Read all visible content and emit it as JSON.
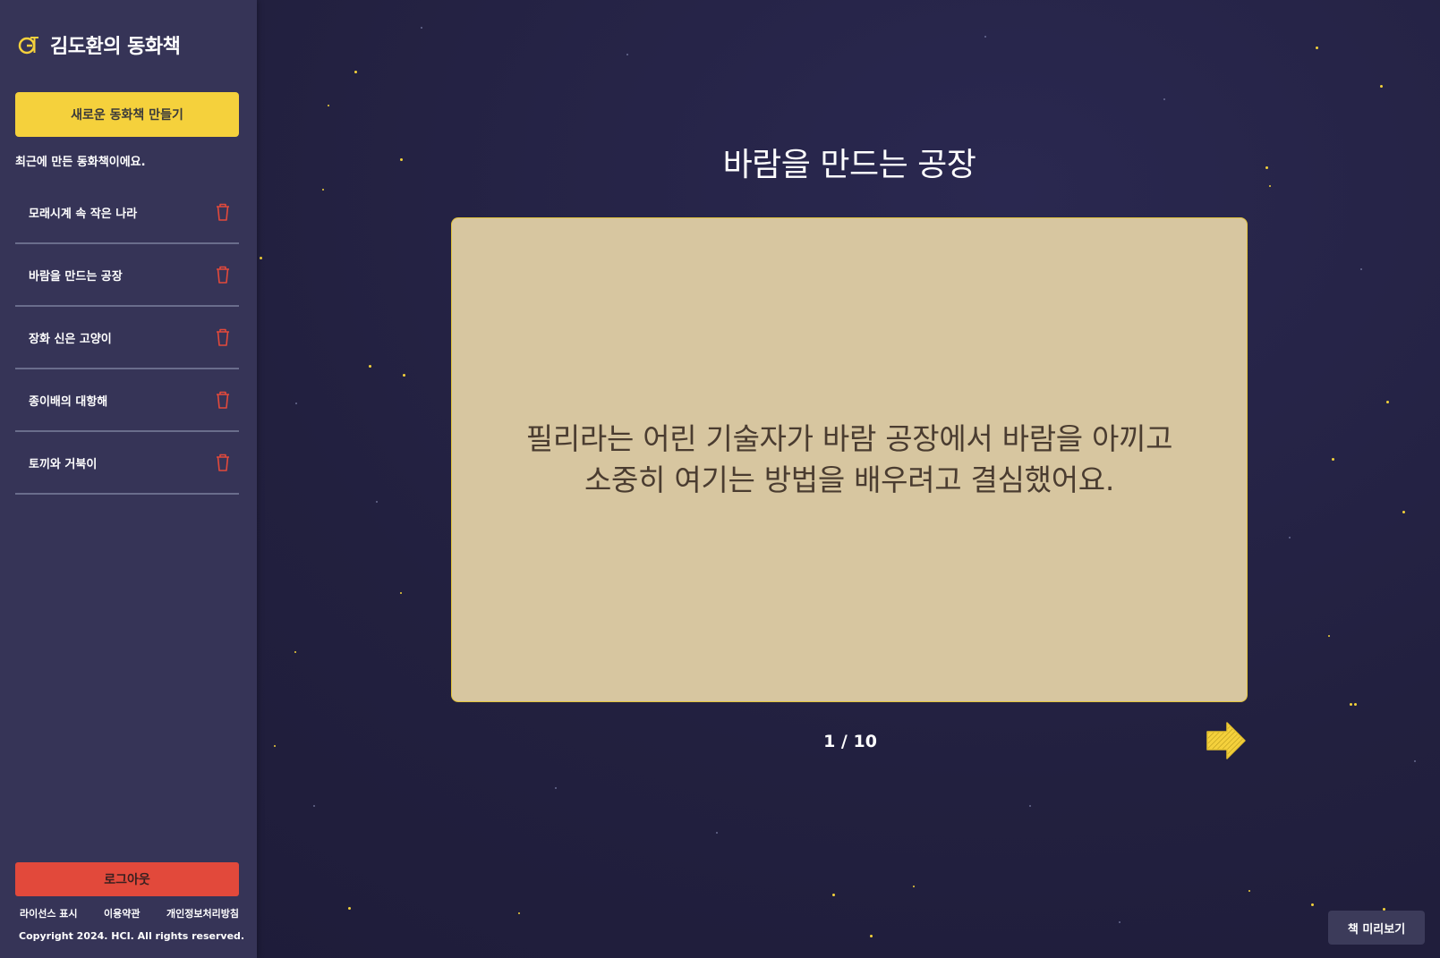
{
  "sidebar": {
    "brand": "김도환의 동화책",
    "new_book_button": "새로운 동화책 만들기",
    "recent_label": "최근에 만든 동화책이에요.",
    "books": [
      {
        "title": "모래시계 속 작은 나라"
      },
      {
        "title": "바람을 만드는 공장"
      },
      {
        "title": "장화 신은 고양이"
      },
      {
        "title": "종이배의 대항해"
      },
      {
        "title": "토끼와 거북이"
      }
    ],
    "logout_button": "로그아웃",
    "footer_links": [
      "라이선스 표시",
      "이용약관",
      "개인정보처리방침"
    ],
    "copyright": "Copyright 2024. HCI. All rights reserved."
  },
  "main": {
    "story_title": "바람을 만드는 공장",
    "page_text": "필리라는 어린 기술자가 바람 공장에서 바람을 아끼고 소중히 여기는 방법을 배우려고 결심했어요.",
    "page_indicator": "1 / 10",
    "preview_button": "책 미리보기"
  },
  "colors": {
    "background": "#22203f",
    "sidebar": "#363457",
    "accent_yellow": "#f5d13c",
    "logout_red": "#e2493b",
    "card": "#d7c6a0"
  },
  "icons": {
    "logo": "gt-logo-icon",
    "delete": "trash-icon",
    "next": "arrow-right-icon"
  }
}
